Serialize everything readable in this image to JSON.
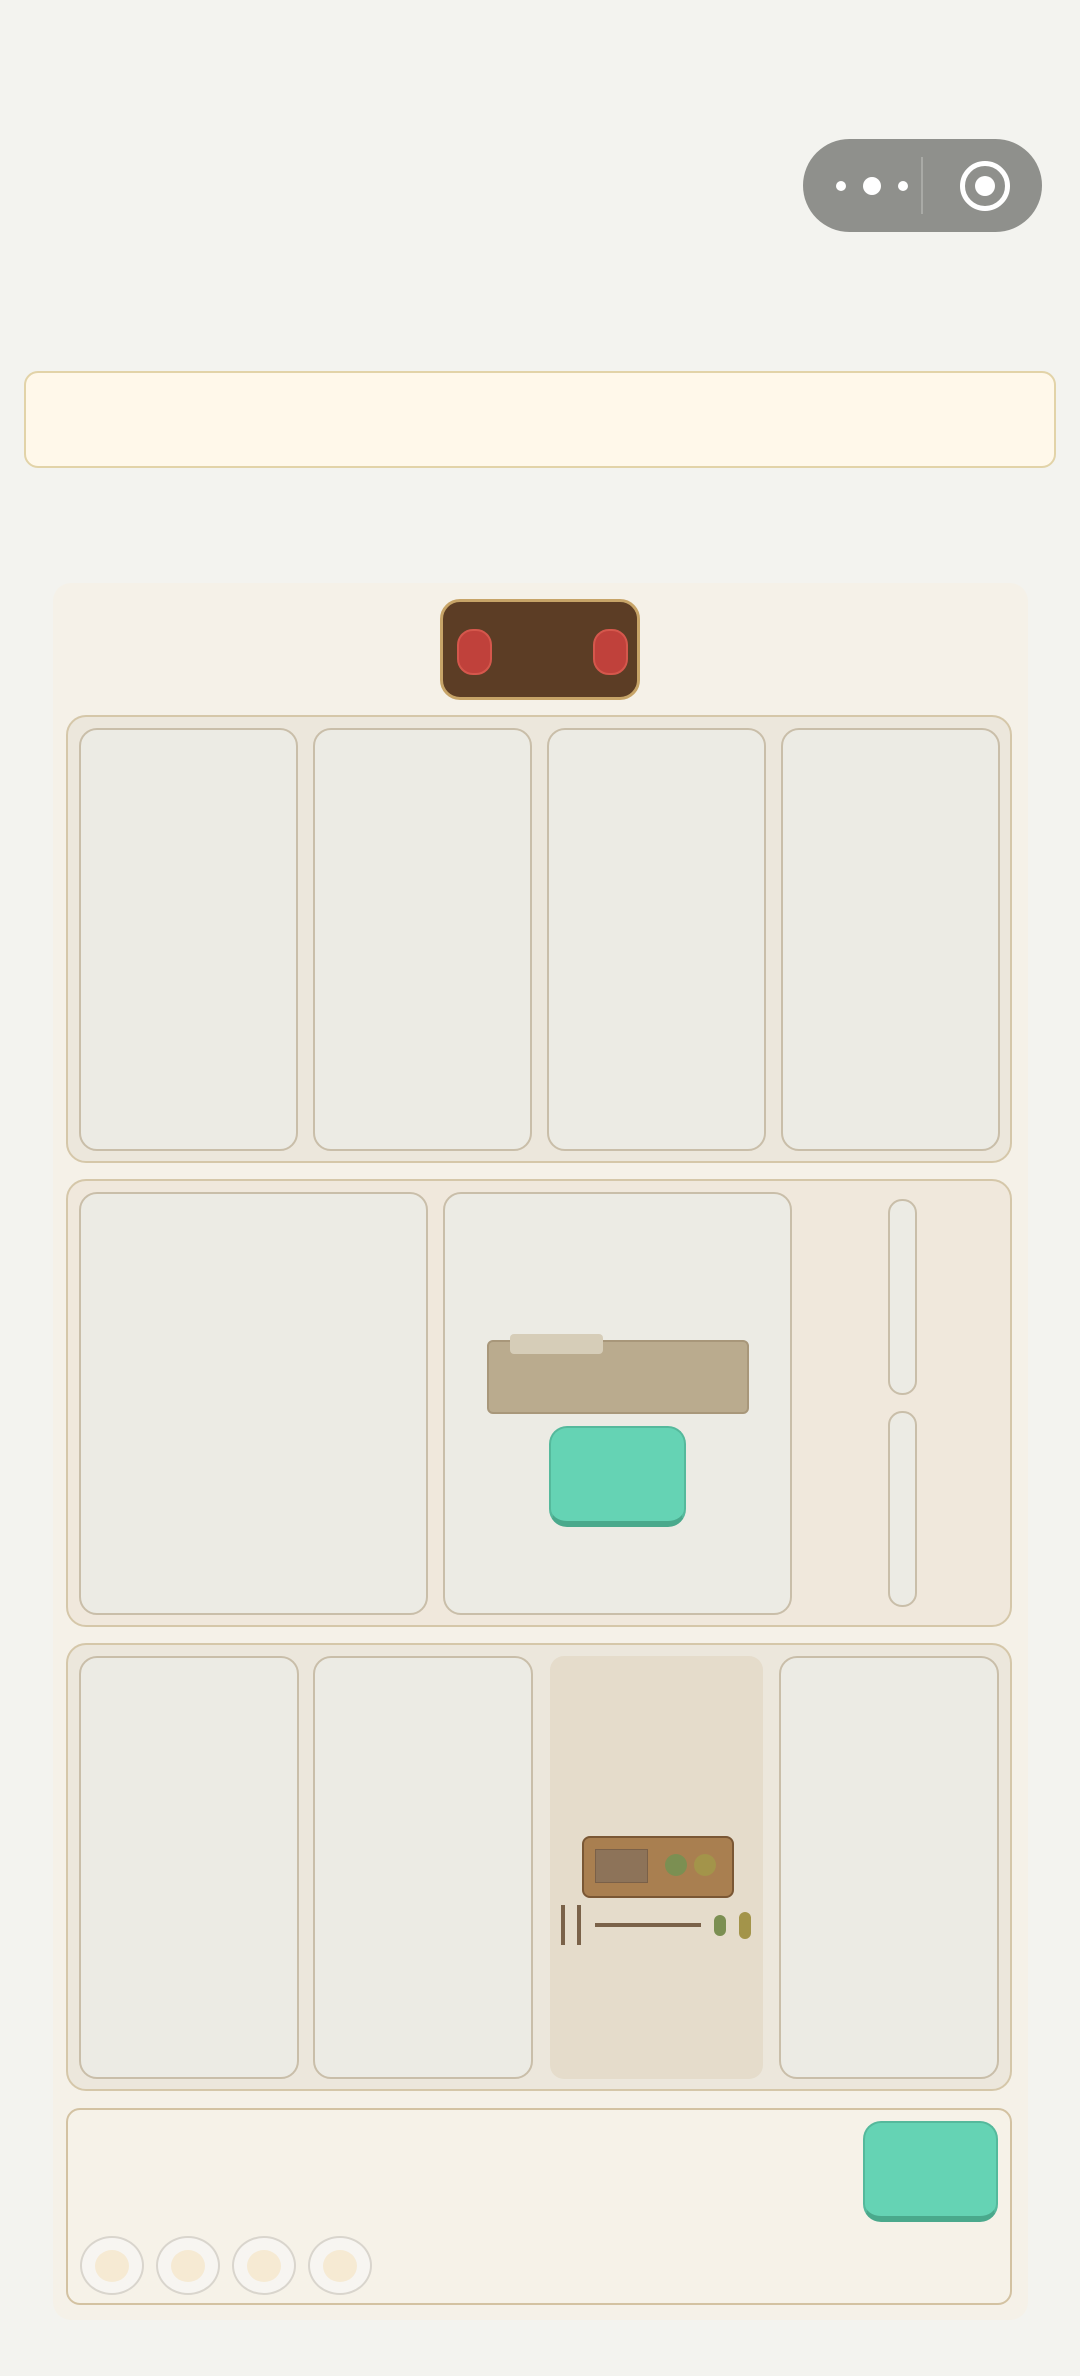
{
  "top_bar": {
    "capsule": {
      "more_icon": "more-dots-icon",
      "close_icon": "target-circle-icon"
    }
  },
  "banner": {
    "text": ""
  },
  "hud": {
    "left_token": "red-pip-icon",
    "right_token": "red-pip-icon"
  },
  "shelves": [
    {
      "slots": 4,
      "items": []
    },
    {
      "slots": 2,
      "items": [
        "plank-item",
        "green-block-button"
      ],
      "side_pills": 2
    },
    {
      "slots": 4,
      "items": [
        "control-panel-item",
        "lever-bar-item"
      ]
    }
  ],
  "tray": {
    "action_button": "green-action-button",
    "slots": 4
  },
  "colors": {
    "background": "#f3f3ef",
    "accent_green": "#65d3b4",
    "hud_brown": "#5c3d25",
    "token_red": "#c0413b",
    "slot_fill": "#ecebe4",
    "shelf_border": "#d5c7a9"
  }
}
